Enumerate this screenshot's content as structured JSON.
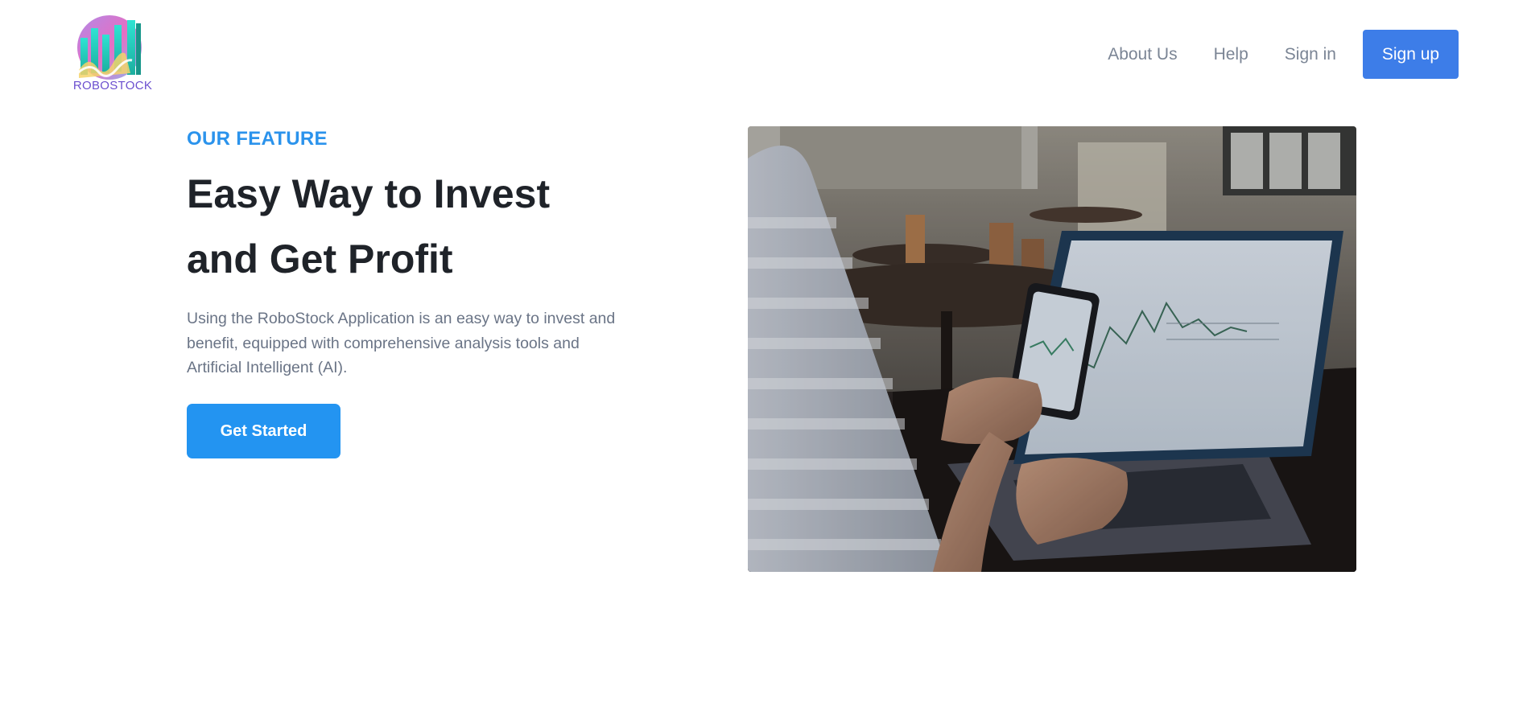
{
  "header": {
    "logo_text": "ROBOSTOCK",
    "nav": {
      "about": "About Us",
      "help": "Help",
      "signin": "Sign in",
      "signup": "Sign up"
    }
  },
  "hero": {
    "eyebrow": "OUR FEATURE",
    "headline_line1": "Easy Way to Invest",
    "headline_line2": "and Get Profit",
    "description": "Using the RoboStock Application is an easy way to invest and benefit, equipped with comprehensive analysis tools and Artificial Intelligent (AI).",
    "cta_label": "Get Started"
  },
  "colors": {
    "primary_blue": "#2394f1",
    "signup_blue": "#3d7de8",
    "eyebrow_blue": "#2b93ec",
    "heading": "#1f2329",
    "body_text": "#6a7486",
    "nav_text": "#7b8595",
    "logo_text": "#6b4fcf"
  },
  "icons": {
    "logo": "robostock-chart-logo"
  }
}
